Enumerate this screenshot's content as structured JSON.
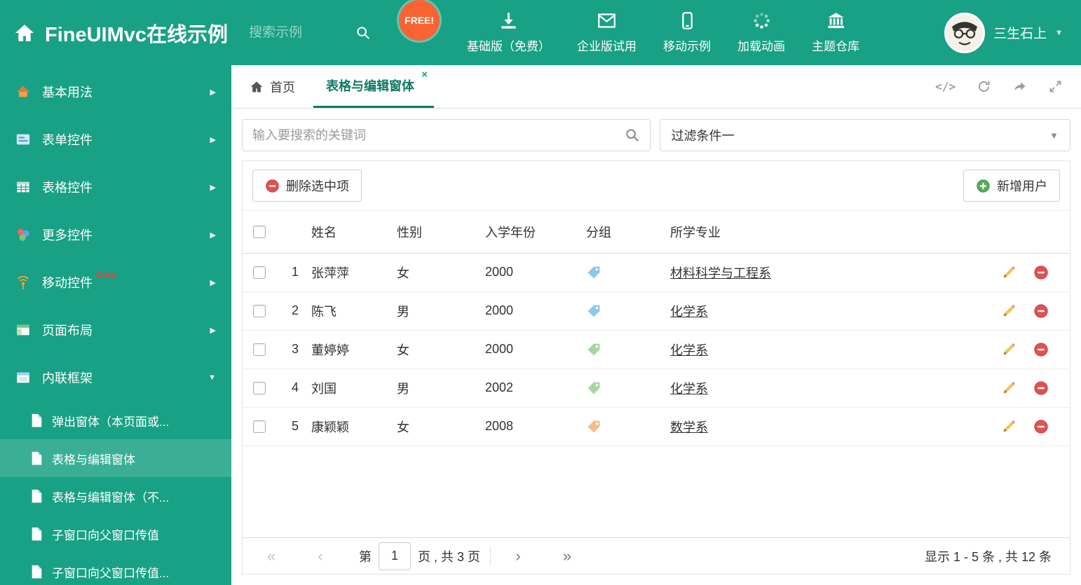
{
  "colors": {
    "primary": "#18a184",
    "primary_dark": "#0e7a65",
    "free_badge": "#f96332",
    "delete_red": "#e25050",
    "add_green": "#57ab57"
  },
  "header": {
    "title": "FineUIMvc在线示例",
    "search_placeholder": "搜索示例",
    "free_badge": "FREE!",
    "nav": [
      {
        "label": "基础版（免费）",
        "icon": "download-icon"
      },
      {
        "label": "企业版试用",
        "icon": "mail-icon"
      },
      {
        "label": "移动示例",
        "icon": "mobile-icon"
      },
      {
        "label": "加载动画",
        "icon": "spinner-icon"
      },
      {
        "label": "主题仓库",
        "icon": "bank-icon"
      }
    ],
    "user_name": "三生石上",
    "user_caret": "▼"
  },
  "sidebar": {
    "items": [
      {
        "label": "基本用法",
        "icon": "home-icon",
        "chevron": "▶"
      },
      {
        "label": "表单控件",
        "icon": "form-icon",
        "chevron": "▶"
      },
      {
        "label": "表格控件",
        "icon": "table-icon",
        "chevron": "▶"
      },
      {
        "label": "更多控件",
        "icon": "more-icon",
        "chevron": "▶"
      },
      {
        "label": "移动控件",
        "icon": "mobile-controls-icon",
        "badge": "Corp",
        "chevron": "▶"
      },
      {
        "label": "页面布局",
        "icon": "layout-icon",
        "chevron": "▶"
      },
      {
        "label": "内联框架",
        "icon": "frame-icon",
        "chevron": "▼"
      }
    ],
    "subitems": [
      {
        "label": "弹出窗体（本页面或..."
      },
      {
        "label": "表格与编辑窗体"
      },
      {
        "label": "表格与编辑窗体（不..."
      },
      {
        "label": "子窗口向父窗口传值"
      },
      {
        "label": "子窗口向父窗口传值..."
      }
    ]
  },
  "tabbar": {
    "home_tab": "首页",
    "active_tab": "表格与编辑窗体",
    "close_glyph": "×",
    "code_glyph": "</>"
  },
  "filters": {
    "search_placeholder": "输入要搜索的关键词",
    "filter_value": "过滤条件一",
    "caret": "▼"
  },
  "grid_toolbar": {
    "delete_label": "删除选中项",
    "add_label": "新增用户"
  },
  "table": {
    "columns": {
      "name": "姓名",
      "gender": "性别",
      "year": "入学年份",
      "group": "分组",
      "major": "所学专业"
    },
    "rows": [
      {
        "index": "1",
        "name": "张萍萍",
        "gender": "女",
        "year": "2000",
        "tag_color": "#8ec7ea",
        "major": "材料科学与工程系"
      },
      {
        "index": "2",
        "name": "陈飞",
        "gender": "男",
        "year": "2000",
        "tag_color": "#8ec7ea",
        "major": "化学系"
      },
      {
        "index": "3",
        "name": "董婷婷",
        "gender": "女",
        "year": "2000",
        "tag_color": "#a5d6a0",
        "major": "化学系"
      },
      {
        "index": "4",
        "name": "刘国",
        "gender": "男",
        "year": "2002",
        "tag_color": "#a5d6a0",
        "major": "化学系"
      },
      {
        "index": "5",
        "name": "康颖颖",
        "gender": "女",
        "year": "2008",
        "tag_color": "#f4be8a",
        "major": "数学系"
      }
    ]
  },
  "pagination": {
    "first": "«",
    "prev": "‹",
    "page_label_prefix": "第",
    "current_page": "1",
    "page_label_suffix": "页 , 共 3 页",
    "next": "›",
    "last": "»",
    "summary": "显示 1 - 5 条 , 共 12 条"
  }
}
